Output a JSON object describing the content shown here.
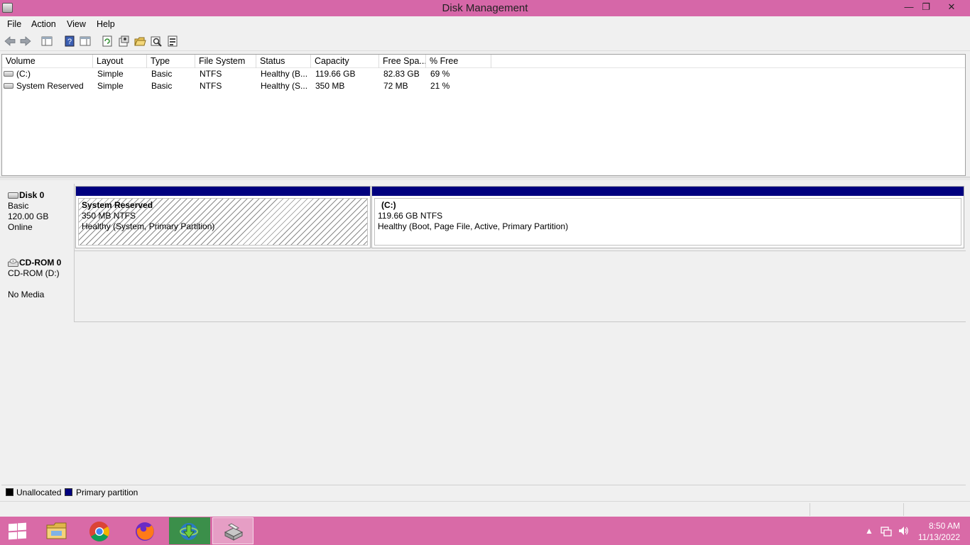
{
  "window": {
    "title": "Disk Management",
    "minimize_glyph": "—",
    "restore_glyph": "❐",
    "close_glyph": "✕"
  },
  "menu": [
    "File",
    "Action",
    "View",
    "Help"
  ],
  "toolbar": {
    "icons": [
      "back-icon",
      "forward-icon",
      "show-hide-console-tree-icon",
      "help-icon",
      "show-hide-action-pane-icon",
      "refresh-icon",
      "properties-icon",
      "open-icon",
      "explore-icon",
      "disk-properties-icon"
    ]
  },
  "volume_list": {
    "columns": [
      "Volume",
      "Layout",
      "Type",
      "File System",
      "Status",
      "Capacity",
      "Free Spa...",
      "% Free"
    ],
    "rows": [
      {
        "volume": "(C:)",
        "layout": "Simple",
        "type": "Basic",
        "fs": "NTFS",
        "status": "Healthy (B...",
        "capacity": "119.66 GB",
        "free": "82.83 GB",
        "pct": "69 %"
      },
      {
        "volume": "System Reserved",
        "layout": "Simple",
        "type": "Basic",
        "fs": "NTFS",
        "status": "Healthy (S...",
        "capacity": "350 MB",
        "free": "72 MB",
        "pct": "21 %"
      }
    ]
  },
  "disks": [
    {
      "name": "Disk 0",
      "kind": "Basic",
      "size": "120.00 GB",
      "state": "Online",
      "partitions": [
        {
          "name": "System Reserved",
          "size": "350 MB NTFS",
          "status": "Healthy (System, Primary Partition)"
        },
        {
          "name": "(C:)",
          "size": "119.66 GB NTFS",
          "status": "Healthy (Boot, Page File, Active, Primary Partition)"
        }
      ]
    },
    {
      "name": "CD-ROM 0",
      "kind": "CD-ROM (D:)",
      "size": "",
      "state": "No Media"
    }
  ],
  "legend": [
    {
      "label": "Unallocated",
      "color": "#000000"
    },
    {
      "label": "Primary partition",
      "color": "#00007f"
    }
  ],
  "taskbar": {
    "apps": [
      "file-explorer-icon",
      "chrome-icon",
      "firefox-icon",
      "internet-download-manager-icon",
      "disk-management-icon"
    ],
    "time": "8:50 AM",
    "date": "11/13/2022"
  },
  "colors": {
    "title_bar": "#d667a8",
    "taskbar": "#d96aa7",
    "primary_partition": "#00007f"
  }
}
